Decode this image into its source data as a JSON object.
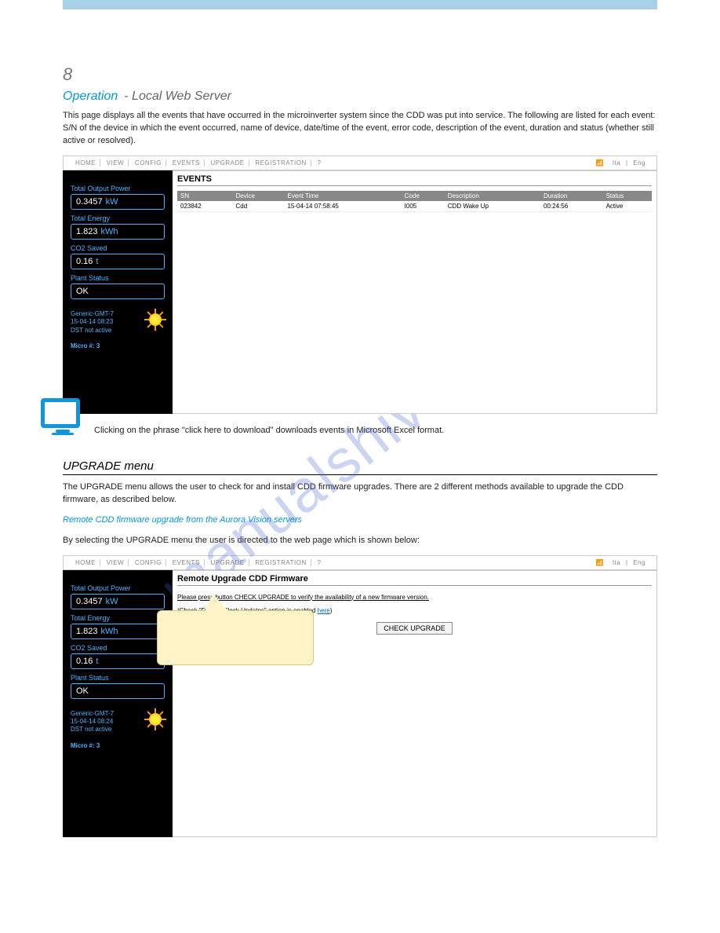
{
  "watermark": "manualshive.com",
  "top": {
    "section_num": "8",
    "title_blue": "Operation",
    "title_gray": "- Local Web Server",
    "intro": "This page displays all the events that have occurred in the microinverter system since the CDD was put into service. The following are listed for each event: S/N of the device in which the event occurred, name of device, date/time of the event, error code, description of the event, duration and status (whether still active or resolved)."
  },
  "nav": {
    "items": [
      "HOME",
      "VIEW",
      "CONFIG",
      "EVENTS",
      "UPGRADE",
      "REGISTRATION",
      "?"
    ],
    "lang": [
      "Ita",
      "Eng"
    ]
  },
  "sidebar": {
    "items": [
      {
        "label": "Total Output Power",
        "value": "0.3457",
        "unit": "kW"
      },
      {
        "label": "Total Energy",
        "value": "1.823",
        "unit": "kWh"
      },
      {
        "label": "CO2 Saved",
        "value": "0.16",
        "unit": "t"
      },
      {
        "label": "Plant Status",
        "value": "OK",
        "unit": ""
      }
    ],
    "meta_tz": "Generic-GMT-7",
    "meta_dt": "15-04-14 08:23",
    "meta_dst": "DST not active",
    "micro": "Micro #: 3"
  },
  "events": {
    "title": "EVENTS",
    "headers": [
      "SN",
      "Device",
      "Event Time",
      "Code",
      "Description",
      "Duration",
      "Status"
    ],
    "rows": [
      {
        "sn": "023842",
        "device": "Cdd",
        "time": "15-04-14 07:58:45",
        "code": "I005",
        "desc": "CDD Wake Up",
        "dur": "00:24:56",
        "status": "Active"
      }
    ]
  },
  "mid": {
    "after_img": "Clicking on the phrase \"click here to download\" downloads events in Microsoft Excel format."
  },
  "upgrade": {
    "section_title": "UPGRADE menu",
    "intro": "The UPGRADE menu allows the user to check for and install CDD firmware upgrades. There are 2 different methods available to upgrade the CDD firmware, as described below.",
    "remote_title": "Remote CDD firmware upgrade from the Aurora Vision servers",
    "remote_intro": "By selecting the UPGRADE menu the user is directed to the web page which is shown below:",
    "panel_title": "Remote Upgrade CDD Firmware",
    "instruction": "Please press button CHECK UPGRADE to verify the availability of a new firmware version.",
    "note_prefix": "(Check \"Fw and Clock Updates\" option is enabled ",
    "note_link": "here",
    "note_suffix": ")",
    "button": "CHECK UPGRADE"
  },
  "sidebar2_dt": "15-04-14 08:24"
}
